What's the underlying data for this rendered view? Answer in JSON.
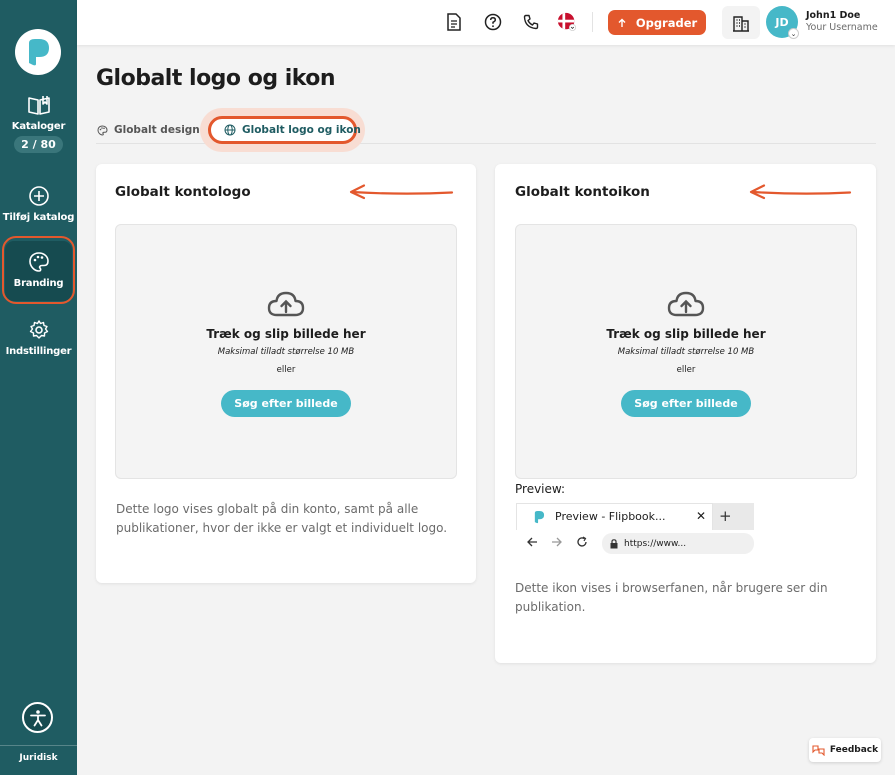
{
  "sidebar": {
    "logo_icon": "publuu-p-logo",
    "items": [
      {
        "label": "Kataloger",
        "badge": "2 / 80",
        "icon": "book-open-icon"
      },
      {
        "label": "Tilføj katalog",
        "icon": "plus-circle-icon"
      },
      {
        "label": "Branding",
        "icon": "palette-icon"
      },
      {
        "label": "Indstillinger",
        "icon": "gear-icon"
      }
    ],
    "accessibility_icon": "accessibility-icon",
    "legal_label": "Juridisk"
  },
  "topbar": {
    "icons": [
      "document-icon",
      "help-icon",
      "phone-icon",
      "denmark-flag-icon"
    ],
    "upgrade_label": "Opgrader",
    "user_initials": "JD",
    "user_name": "John1 Doe",
    "user_subtitle": "Your Username"
  },
  "page": {
    "title": "Globalt logo og ikon",
    "tabs": [
      {
        "label": "Globalt design",
        "icon": "palette-icon",
        "active": false
      },
      {
        "label": "Globalt logo og ikon",
        "icon": "globe-icon",
        "active": true
      }
    ]
  },
  "cards": {
    "logo": {
      "title": "Globalt kontologo",
      "drop_title": "Træk og slip billede her",
      "drop_sub": "Maksimal tilladt størrelse 10 MB",
      "drop_or": "eller",
      "button": "Søg efter billede",
      "description": "Dette logo vises globalt på din konto, samt på alle publikationer, hvor der ikke er valgt et individuelt logo."
    },
    "icon": {
      "title": "Globalt kontoikon",
      "drop_title": "Træk og slip billede her",
      "drop_sub": "Maksimal tilladt størrelse 10 MB",
      "drop_or": "eller",
      "button": "Søg efter billede",
      "preview_label": "Preview:",
      "browser_tab_title": "Preview - Flipbook...",
      "browser_url": "https://www...",
      "description": "Dette ikon vises i browserfanen, når brugere ser din publikation."
    }
  },
  "feedback_label": "Feedback",
  "colors": {
    "sidebar": "#1f5c62",
    "accent": "#e3582d",
    "primary": "#46b8c8"
  }
}
